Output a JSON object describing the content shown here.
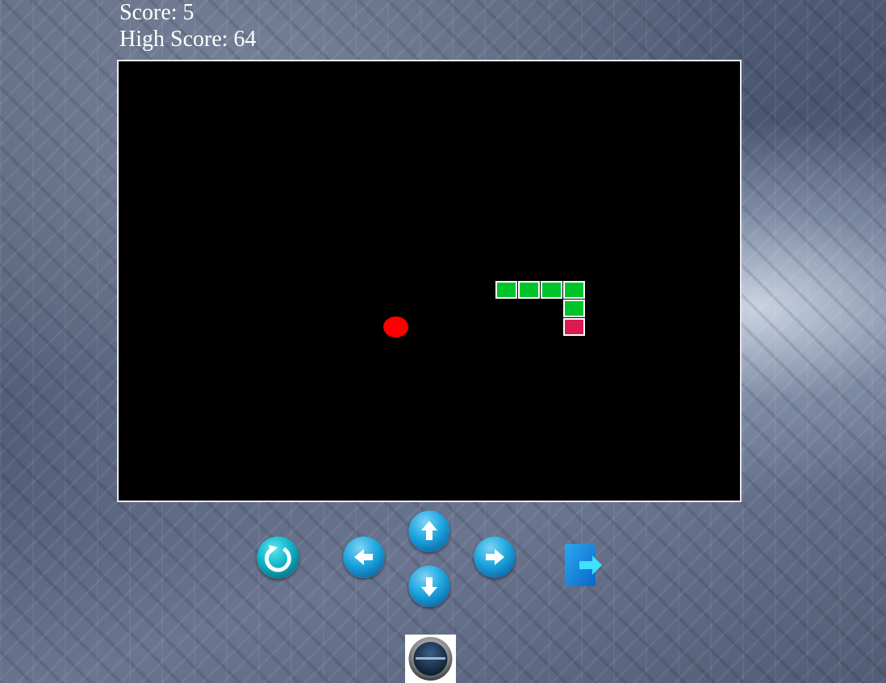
{
  "score_label": "Score: 5",
  "high_score_label": "High Score: 64",
  "game": {
    "score": 5,
    "high_score": 64,
    "board_color": "#000000",
    "snake_body_color": "#00c52a",
    "snake_tail_color": "#d81b50",
    "food_color": "#ff0000"
  },
  "controls": {
    "restart_icon": "restart-icon",
    "up_icon": "arrow-up-icon",
    "down_icon": "arrow-down-icon",
    "left_icon": "arrow-left-icon",
    "right_icon": "arrow-right-icon",
    "exit_icon": "exit-icon",
    "accent_color": "#1ea7e0"
  },
  "logo": {
    "icon": "logo-badge-icon"
  }
}
